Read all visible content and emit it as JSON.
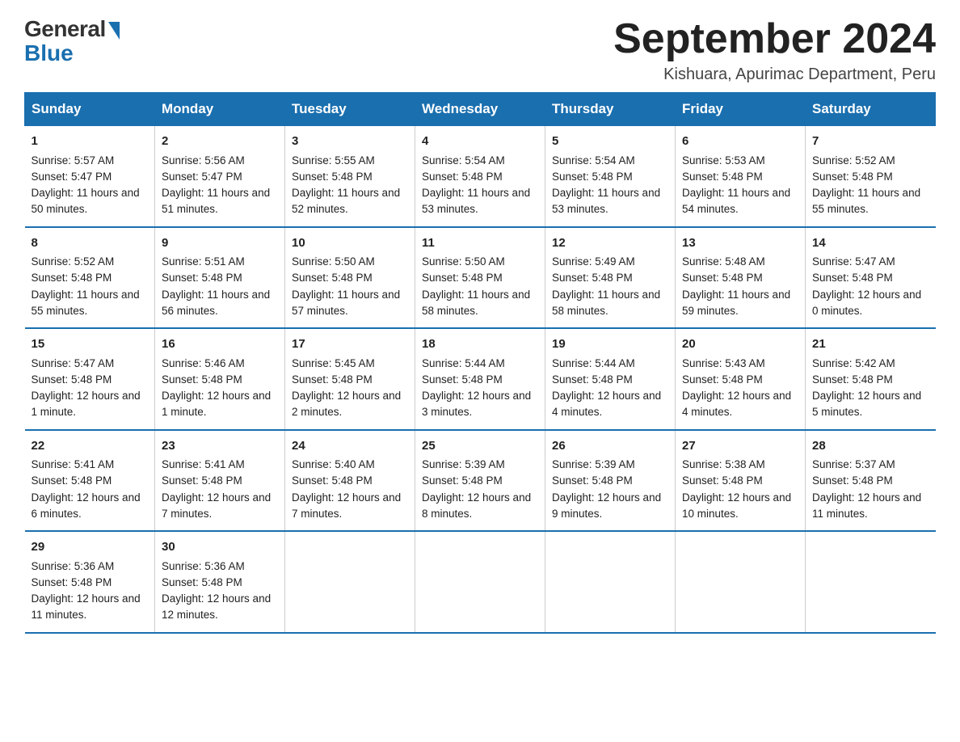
{
  "logo": {
    "general": "General",
    "blue": "Blue"
  },
  "title": {
    "month_year": "September 2024",
    "location": "Kishuara, Apurimac Department, Peru"
  },
  "days_header": [
    "Sunday",
    "Monday",
    "Tuesday",
    "Wednesday",
    "Thursday",
    "Friday",
    "Saturday"
  ],
  "weeks": [
    [
      {
        "day": "1",
        "sunrise": "Sunrise: 5:57 AM",
        "sunset": "Sunset: 5:47 PM",
        "daylight": "Daylight: 11 hours and 50 minutes."
      },
      {
        "day": "2",
        "sunrise": "Sunrise: 5:56 AM",
        "sunset": "Sunset: 5:47 PM",
        "daylight": "Daylight: 11 hours and 51 minutes."
      },
      {
        "day": "3",
        "sunrise": "Sunrise: 5:55 AM",
        "sunset": "Sunset: 5:48 PM",
        "daylight": "Daylight: 11 hours and 52 minutes."
      },
      {
        "day": "4",
        "sunrise": "Sunrise: 5:54 AM",
        "sunset": "Sunset: 5:48 PM",
        "daylight": "Daylight: 11 hours and 53 minutes."
      },
      {
        "day": "5",
        "sunrise": "Sunrise: 5:54 AM",
        "sunset": "Sunset: 5:48 PM",
        "daylight": "Daylight: 11 hours and 53 minutes."
      },
      {
        "day": "6",
        "sunrise": "Sunrise: 5:53 AM",
        "sunset": "Sunset: 5:48 PM",
        "daylight": "Daylight: 11 hours and 54 minutes."
      },
      {
        "day": "7",
        "sunrise": "Sunrise: 5:52 AM",
        "sunset": "Sunset: 5:48 PM",
        "daylight": "Daylight: 11 hours and 55 minutes."
      }
    ],
    [
      {
        "day": "8",
        "sunrise": "Sunrise: 5:52 AM",
        "sunset": "Sunset: 5:48 PM",
        "daylight": "Daylight: 11 hours and 55 minutes."
      },
      {
        "day": "9",
        "sunrise": "Sunrise: 5:51 AM",
        "sunset": "Sunset: 5:48 PM",
        "daylight": "Daylight: 11 hours and 56 minutes."
      },
      {
        "day": "10",
        "sunrise": "Sunrise: 5:50 AM",
        "sunset": "Sunset: 5:48 PM",
        "daylight": "Daylight: 11 hours and 57 minutes."
      },
      {
        "day": "11",
        "sunrise": "Sunrise: 5:50 AM",
        "sunset": "Sunset: 5:48 PM",
        "daylight": "Daylight: 11 hours and 58 minutes."
      },
      {
        "day": "12",
        "sunrise": "Sunrise: 5:49 AM",
        "sunset": "Sunset: 5:48 PM",
        "daylight": "Daylight: 11 hours and 58 minutes."
      },
      {
        "day": "13",
        "sunrise": "Sunrise: 5:48 AM",
        "sunset": "Sunset: 5:48 PM",
        "daylight": "Daylight: 11 hours and 59 minutes."
      },
      {
        "day": "14",
        "sunrise": "Sunrise: 5:47 AM",
        "sunset": "Sunset: 5:48 PM",
        "daylight": "Daylight: 12 hours and 0 minutes."
      }
    ],
    [
      {
        "day": "15",
        "sunrise": "Sunrise: 5:47 AM",
        "sunset": "Sunset: 5:48 PM",
        "daylight": "Daylight: 12 hours and 1 minute."
      },
      {
        "day": "16",
        "sunrise": "Sunrise: 5:46 AM",
        "sunset": "Sunset: 5:48 PM",
        "daylight": "Daylight: 12 hours and 1 minute."
      },
      {
        "day": "17",
        "sunrise": "Sunrise: 5:45 AM",
        "sunset": "Sunset: 5:48 PM",
        "daylight": "Daylight: 12 hours and 2 minutes."
      },
      {
        "day": "18",
        "sunrise": "Sunrise: 5:44 AM",
        "sunset": "Sunset: 5:48 PM",
        "daylight": "Daylight: 12 hours and 3 minutes."
      },
      {
        "day": "19",
        "sunrise": "Sunrise: 5:44 AM",
        "sunset": "Sunset: 5:48 PM",
        "daylight": "Daylight: 12 hours and 4 minutes."
      },
      {
        "day": "20",
        "sunrise": "Sunrise: 5:43 AM",
        "sunset": "Sunset: 5:48 PM",
        "daylight": "Daylight: 12 hours and 4 minutes."
      },
      {
        "day": "21",
        "sunrise": "Sunrise: 5:42 AM",
        "sunset": "Sunset: 5:48 PM",
        "daylight": "Daylight: 12 hours and 5 minutes."
      }
    ],
    [
      {
        "day": "22",
        "sunrise": "Sunrise: 5:41 AM",
        "sunset": "Sunset: 5:48 PM",
        "daylight": "Daylight: 12 hours and 6 minutes."
      },
      {
        "day": "23",
        "sunrise": "Sunrise: 5:41 AM",
        "sunset": "Sunset: 5:48 PM",
        "daylight": "Daylight: 12 hours and 7 minutes."
      },
      {
        "day": "24",
        "sunrise": "Sunrise: 5:40 AM",
        "sunset": "Sunset: 5:48 PM",
        "daylight": "Daylight: 12 hours and 7 minutes."
      },
      {
        "day": "25",
        "sunrise": "Sunrise: 5:39 AM",
        "sunset": "Sunset: 5:48 PM",
        "daylight": "Daylight: 12 hours and 8 minutes."
      },
      {
        "day": "26",
        "sunrise": "Sunrise: 5:39 AM",
        "sunset": "Sunset: 5:48 PM",
        "daylight": "Daylight: 12 hours and 9 minutes."
      },
      {
        "day": "27",
        "sunrise": "Sunrise: 5:38 AM",
        "sunset": "Sunset: 5:48 PM",
        "daylight": "Daylight: 12 hours and 10 minutes."
      },
      {
        "day": "28",
        "sunrise": "Sunrise: 5:37 AM",
        "sunset": "Sunset: 5:48 PM",
        "daylight": "Daylight: 12 hours and 11 minutes."
      }
    ],
    [
      {
        "day": "29",
        "sunrise": "Sunrise: 5:36 AM",
        "sunset": "Sunset: 5:48 PM",
        "daylight": "Daylight: 12 hours and 11 minutes."
      },
      {
        "day": "30",
        "sunrise": "Sunrise: 5:36 AM",
        "sunset": "Sunset: 5:48 PM",
        "daylight": "Daylight: 12 hours and 12 minutes."
      },
      null,
      null,
      null,
      null,
      null
    ]
  ]
}
